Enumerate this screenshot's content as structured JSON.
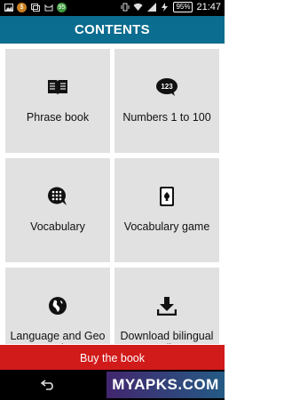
{
  "status_bar": {
    "battery": "95%",
    "time": "21:47",
    "badge": "95"
  },
  "header": {
    "title": "CONTENTS"
  },
  "tiles": [
    {
      "label": "Phrase book",
      "icon": "book-icon"
    },
    {
      "label": "Numbers 1 to 100",
      "icon": "numbers-bubble-icon",
      "icon_text": "123"
    },
    {
      "label": "Vocabulary",
      "icon": "vocabulary-grid-bubble-icon"
    },
    {
      "label": "Vocabulary game",
      "icon": "playing-card-icon"
    },
    {
      "label": "Language and Geo Quiz",
      "icon": "globe-icon"
    },
    {
      "label": "Download bilingual audios",
      "icon": "download-icon"
    }
  ],
  "footer": {
    "buy_label": "Buy the book"
  },
  "watermark": "MYAPKS.COM",
  "colors": {
    "header": "#0b6d8f",
    "buy_button": "#d11a1a",
    "tile": "#e1e1e1"
  }
}
